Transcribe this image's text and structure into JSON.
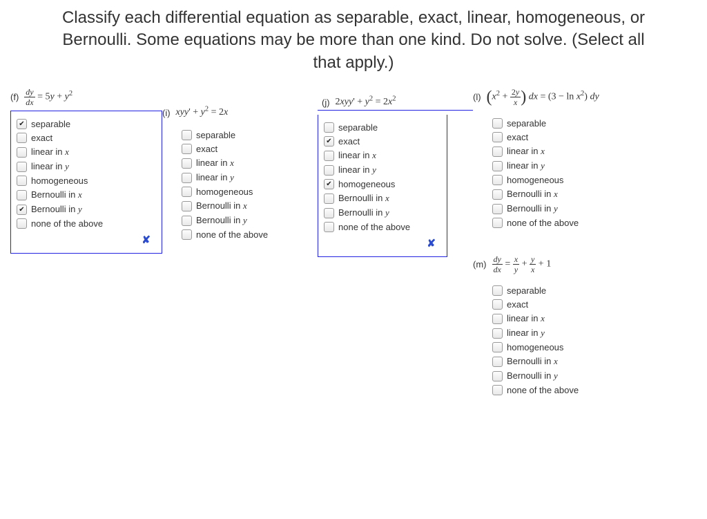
{
  "header": "Classify each differential equation as separable, exact, linear, homogeneous, or Bernoulli. Some equations may be more than one kind. Do not solve. (Select all that apply.)",
  "option_labels": {
    "separable": "separable",
    "exact": "exact",
    "linear_x": "linear in ",
    "linear_x_var": "x",
    "linear_y": "linear in ",
    "linear_y_var": "y",
    "homogeneous": "homogeneous",
    "bernoulli_x": "Bernoulli in ",
    "bernoulli_x_var": "x",
    "bernoulli_y": "Bernoulli in ",
    "bernoulli_y_var": "y",
    "none": "none of the above"
  },
  "problems": {
    "f": {
      "letter": "(f)",
      "equation_html": "<span class='frac'><span class='num'><span class='i'>dy</span></span><span class='den'><span class='i'>dx</span></span></span> = 5<span class='i'>y</span> + <span class='i'>y</span><sup>2</sup>",
      "boxed": true,
      "marked_wrong": true,
      "checked": {
        "separable": true,
        "bernoulli_y": true
      }
    },
    "i": {
      "letter": "(i)",
      "equation_html": "<span class='i'>xyy</span>' + <span class='i'>y</span><sup>2</sup> = 2<span class='i'>x</span>",
      "boxed": false,
      "marked_wrong": false,
      "checked": {}
    },
    "j": {
      "letter": "(j)",
      "equation_html": "2<span class='i'>xyy</span>' + <span class='i'>y</span><sup>2</sup> = 2<span class='i'>x</span><sup>2</sup>",
      "boxed": true,
      "marked_wrong": true,
      "checked": {
        "exact": true,
        "homogeneous": true
      }
    },
    "l": {
      "letter": "(l)",
      "equation_html": "<span class='paren-l'>(</span><span class='i'>x</span><sup>2</sup> + <span class='frac'><span class='num'>2<span class='i'>y</span></span><span class='den'><span class='i'>x</span></span></span><span class='paren-r'>)</span> <span class='i'>dx</span> = (3 &minus; ln <span class='i'>x</span><sup>2</sup>) <span class='i'>dy</span>",
      "boxed": false,
      "marked_wrong": false,
      "checked": {}
    },
    "m": {
      "letter": "(m)",
      "equation_html": "<span class='frac'><span class='num'><span class='i'>dy</span></span><span class='den'><span class='i'>dx</span></span></span> = <span class='frac'><span class='num'><span class='i'>x</span></span><span class='den'><span class='i'>y</span></span></span> + <span class='frac'><span class='num'><span class='i'>y</span></span><span class='den'><span class='i'>x</span></span></span> + 1",
      "boxed": false,
      "marked_wrong": false,
      "checked": {}
    }
  },
  "wrong_mark": "✘"
}
